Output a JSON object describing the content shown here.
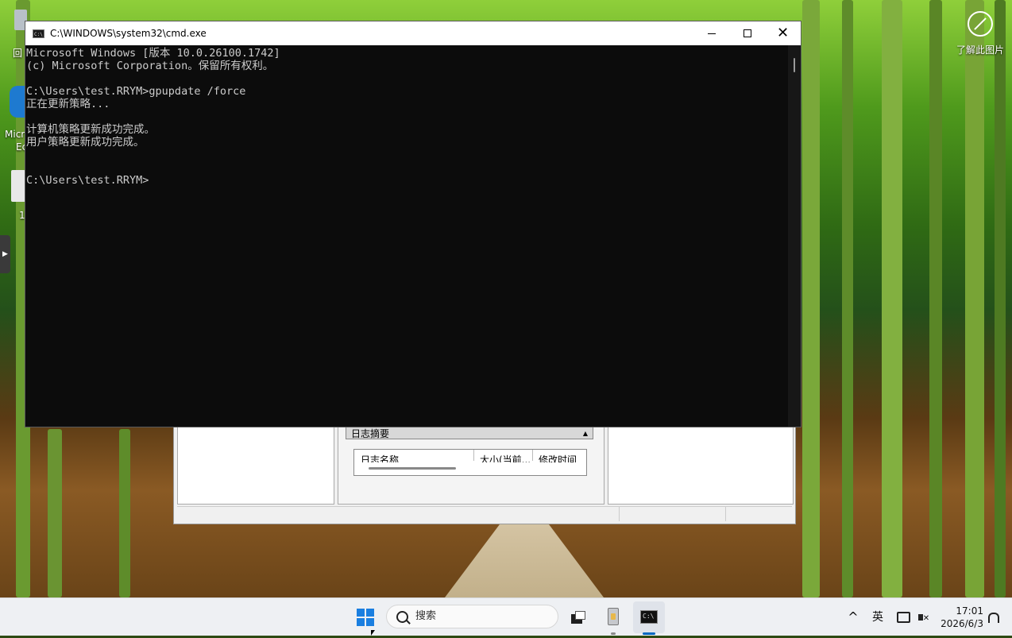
{
  "desktop": {
    "icons": [
      {
        "label": "回"
      },
      {
        "label": "Micr"
      },
      {
        "label": "Ec"
      },
      {
        "label": "1"
      }
    ],
    "learn_more": {
      "label": "了解此图片",
      "icon": "camera-info-icon"
    }
  },
  "cmd_window": {
    "title": "C:\\WINDOWS\\system32\\cmd.exe",
    "buttons": {
      "minimize": "─",
      "maximize": "□",
      "close": "✕"
    },
    "lines": [
      "Microsoft Windows [版本 10.0.26100.1742]",
      "(c) Microsoft Corporation。保留所有权利。",
      "",
      "C:\\Users\\test.RRYM>gpupdate /force",
      "正在更新策略...",
      "",
      "计算机策略更新成功完成。",
      "用户策略更新成功完成。",
      "",
      "",
      "C:\\Users\\test.RRYM>"
    ]
  },
  "background_window": {
    "summary_title": "日志摘要",
    "summary_arrow": "▲",
    "columns": [
      "日志名称",
      "大小(当前...",
      "修改时间"
    ]
  },
  "taskbar": {
    "search_placeholder": "搜索",
    "ime": "英",
    "time": "17:01",
    "date": "2026/6/3",
    "tray_chevron": "^",
    "colors": {
      "accent": "#1a7fe0",
      "indicator": "#0067c0"
    }
  }
}
